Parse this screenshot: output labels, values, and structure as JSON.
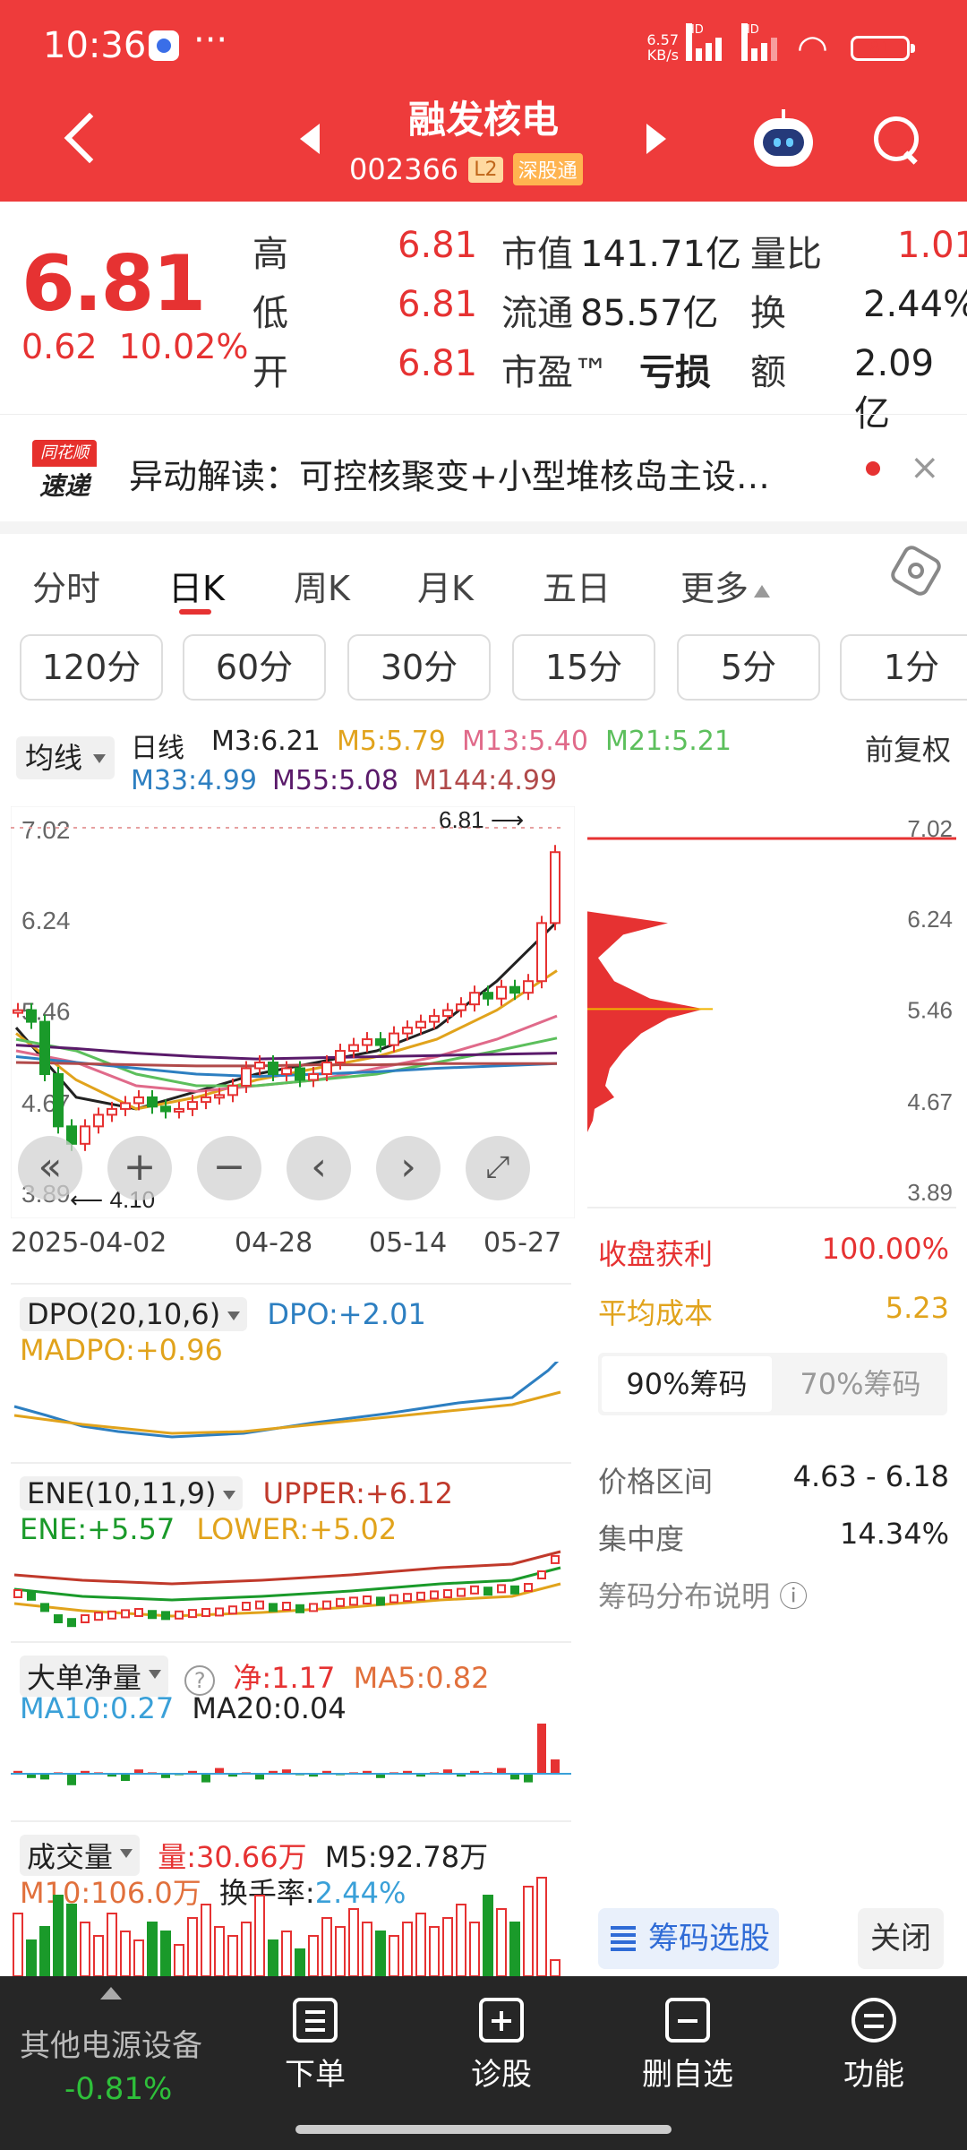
{
  "status": {
    "time": "10:36",
    "dots": "···",
    "speed_value": "6.57",
    "speed_unit": "KB/s",
    "hd": "HD",
    "battery": "81"
  },
  "header": {
    "stock_name": "融发核电",
    "stock_code": "002366",
    "tag_l2": "L2",
    "tag_connect": "深股通"
  },
  "quote": {
    "price": "6.81",
    "change": "0.62",
    "change_pct": "10.02%",
    "high_label": "高",
    "high": "6.81",
    "low_label": "低",
    "low": "6.81",
    "open_label": "开",
    "open": "6.81",
    "mktcap_label": "市值",
    "mktcap": "141.71亿",
    "float_label": "流通",
    "float": "85.57亿",
    "pe_label": "市盈™",
    "pe": "亏损",
    "vol_ratio_label": "量比",
    "vol_ratio": "1.01",
    "turnover_label": "换",
    "turnover": "2.44%",
    "amount_label": "额",
    "amount": "2.09亿"
  },
  "news": {
    "logo_top": "同花顺",
    "logo_bottom": "速递",
    "text": "异动解读：可控核聚变+小型堆核岛主设…",
    "close": "×"
  },
  "tabs": [
    "分时",
    "日K",
    "周K",
    "月K",
    "五日",
    "更多"
  ],
  "periods": [
    "120分",
    "60分",
    "30分",
    "15分",
    "5分",
    "1分"
  ],
  "ma_header": {
    "select": "均线",
    "kind": "日线",
    "fq": "前复权",
    "m3": "M3:6.21",
    "m5": "M5:5.79",
    "m13": "M13:5.40",
    "m21": "M21:5.21",
    "m33": "M33:4.99",
    "m55": "M55:5.08",
    "m144": "M144:4.99"
  },
  "kchart": {
    "y_ticks": [
      "7.02",
      "6.24",
      "5.46",
      "4.67",
      "3.89"
    ],
    "high_marker": "6.81",
    "low_marker": "4.10",
    "dates": [
      "2025-04-02",
      "04-28",
      "05-14",
      "05-27"
    ]
  },
  "chart_data": {
    "type": "line",
    "title": "",
    "x": [
      "2025-04-02",
      "04-28",
      "05-14",
      "05-27"
    ],
    "ylim": [
      3.89,
      7.02
    ],
    "y_ticks": [
      7.02,
      6.24,
      5.46,
      4.67,
      3.89
    ],
    "series": [
      {
        "name": "M3",
        "values": [
          5.3,
          4.7,
          4.6,
          4.75,
          4.9,
          5.0,
          5.1,
          5.3,
          5.7,
          6.21
        ]
      },
      {
        "name": "M5",
        "values": [
          5.25,
          4.85,
          4.6,
          4.7,
          4.85,
          4.95,
          5.05,
          5.2,
          5.45,
          5.79
        ]
      },
      {
        "name": "M13",
        "values": [
          5.1,
          5.0,
          4.8,
          4.75,
          4.8,
          4.85,
          4.95,
          5.05,
          5.2,
          5.4
        ]
      },
      {
        "name": "M21",
        "values": [
          5.2,
          5.1,
          4.9,
          4.8,
          4.8,
          4.85,
          4.9,
          5.0,
          5.1,
          5.21
        ]
      },
      {
        "name": "M33",
        "values": [
          5.05,
          5.0,
          4.95,
          4.9,
          4.88,
          4.9,
          4.92,
          4.95,
          4.97,
          4.99
        ]
      },
      {
        "name": "M55",
        "values": [
          5.15,
          5.12,
          5.08,
          5.05,
          5.03,
          5.04,
          5.05,
          5.06,
          5.07,
          5.08
        ]
      },
      {
        "name": "M144",
        "values": [
          5.0,
          4.99,
          4.98,
          4.97,
          4.97,
          4.98,
          4.98,
          4.99,
          4.99,
          4.99
        ]
      }
    ]
  },
  "chip": {
    "y_ticks": [
      "7.02",
      "6.24",
      "5.46",
      "4.67",
      "3.89"
    ],
    "profit_label": "收盘获利",
    "profit": "100.00%",
    "avg_cost_label": "平均成本",
    "avg_cost": "5.23",
    "tab90": "90%筹码",
    "tab70": "70%筹码",
    "range_label": "价格区间",
    "range": "4.63 - 6.18",
    "conc_label": "集中度",
    "conc": "14.34%",
    "explain": "筹码分布说明 ⓘ",
    "select_btn": "筹码选股",
    "close_btn": "关闭"
  },
  "dpo": {
    "select": "DPO(20,10,6)",
    "dpo": "DPO:+2.01",
    "madpo": "MADPO:+0.96"
  },
  "ene": {
    "select": "ENE(10,11,9)",
    "upper": "UPPER:+6.12",
    "ene": "ENE:+5.57",
    "lower": "LOWER:+5.02"
  },
  "ddj": {
    "select": "大单净量",
    "help": "?",
    "net": "净:1.17",
    "ma5": "MA5:0.82",
    "ma10": "MA10:0.27",
    "ma20": "MA20:0.04"
  },
  "vol": {
    "select": "成交量",
    "vol": "量:30.66万",
    "m5": "M5:92.78万",
    "m10": "M10:106.0万",
    "turnover_label": "换手率:",
    "turnover": "2.44%"
  },
  "bottom": {
    "sector": "其他电源设备",
    "sector_change": "-0.81%",
    "items": [
      "下单",
      "诊股",
      "删自选",
      "功能"
    ]
  },
  "colors": {
    "red": "#e63232",
    "green": "#1a9a2a",
    "header": "#ee3b3b"
  }
}
